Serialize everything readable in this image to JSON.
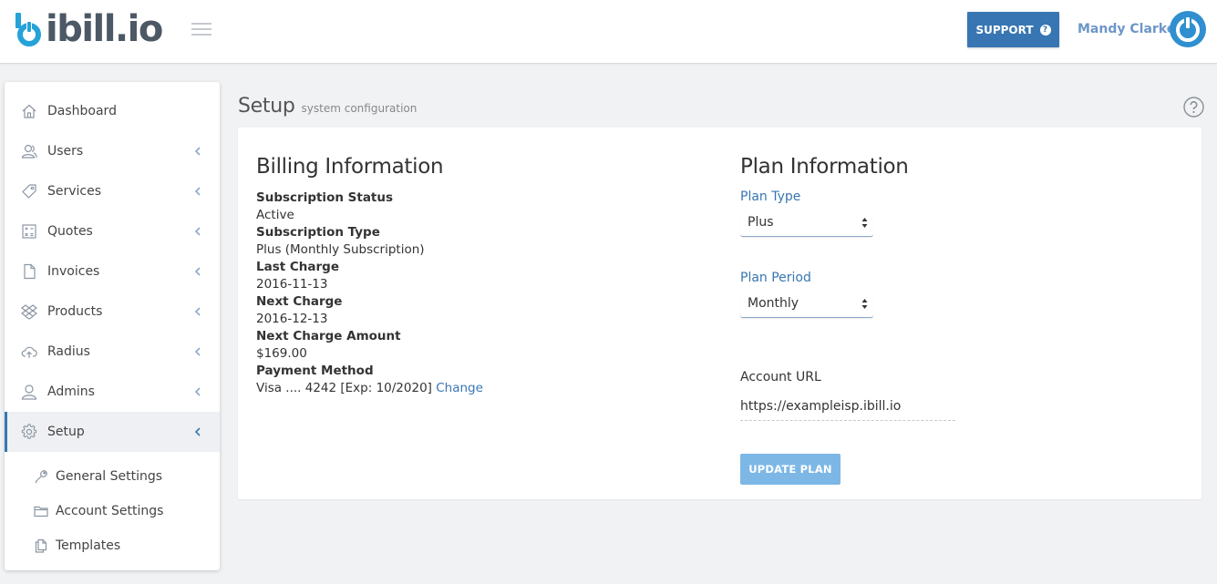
{
  "header": {
    "logo_text": "ibill.io",
    "support_label": "SUPPORT",
    "support_icon_glyph": "?",
    "user_name": "Mandy Clarke"
  },
  "colors": {
    "brand_blue": "#3876b3",
    "logo_cyan": "#25a2d8",
    "avatar_blue": "#2f8fd0",
    "button_disabled": "#7cb7e6"
  },
  "sidebar": {
    "items": [
      {
        "label": "Dashboard",
        "icon": "home-icon"
      },
      {
        "label": "Users",
        "icon": "users-icon"
      },
      {
        "label": "Services",
        "icon": "tag-icon"
      },
      {
        "label": "Quotes",
        "icon": "calculator-icon"
      },
      {
        "label": "Invoices",
        "icon": "document-icon"
      },
      {
        "label": "Products",
        "icon": "dropbox-icon"
      },
      {
        "label": "Radius",
        "icon": "cloud-upload-icon"
      },
      {
        "label": "Admins",
        "icon": "user-icon"
      },
      {
        "label": "Setup",
        "icon": "gear-icon",
        "active": true
      }
    ],
    "sub_items": [
      {
        "label": "General Settings",
        "icon": "wrench-icon"
      },
      {
        "label": "Account Settings",
        "icon": "folder-icon"
      },
      {
        "label": "Templates",
        "icon": "copy-icon"
      }
    ]
  },
  "page": {
    "title": "Setup",
    "subtitle": "system configuration"
  },
  "billing": {
    "title": "Billing Information",
    "subscription_status_label": "Subscription Status",
    "subscription_status": "Active",
    "subscription_type_label": "Subscription Type",
    "subscription_type": "Plus (Monthly Subscription)",
    "last_charge_label": "Last Charge",
    "last_charge": "2016-11-13",
    "next_charge_label": "Next Charge",
    "next_charge": "2016-12-13",
    "next_charge_amount_label": "Next Charge Amount",
    "next_charge_amount": "$169.00",
    "payment_method_label": "Payment Method",
    "payment_method": "Visa .... 4242 [Exp: 10/2020]",
    "change_link": "Change"
  },
  "plan": {
    "title": "Plan Information",
    "plan_type_label": "Plan Type",
    "plan_type_value": "Plus",
    "plan_period_label": "Plan Period",
    "plan_period_value": "Monthly",
    "account_url_label": "Account URL",
    "account_url_value": "https://exampleisp.ibill.io",
    "update_button": "UPDATE PLAN"
  }
}
